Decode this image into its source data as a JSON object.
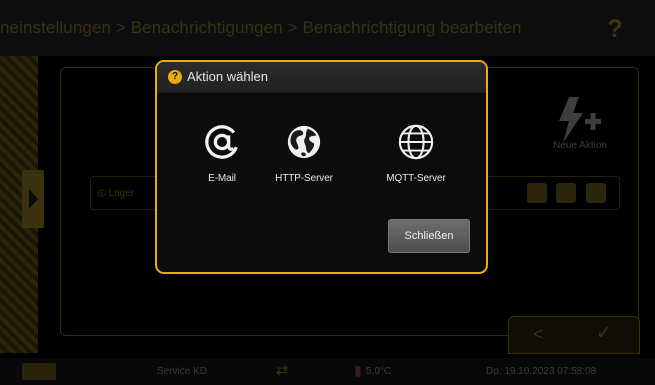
{
  "topbar": {
    "breadcrumb": "neinstellungen > Benachrichtigungen > Benachrichtigung bearbeiten",
    "help_glyph": "?"
  },
  "background": {
    "new_action_label": "Neue Aktion",
    "notification_row_label": "Lager"
  },
  "modal": {
    "help_glyph": "?",
    "title": "Aktion wählen",
    "actions": [
      {
        "label": "E-Mail",
        "icon": "at-sign-icon"
      },
      {
        "label": "HTTP-Server",
        "icon": "globe-icon"
      },
      {
        "label": "MQTT-Server",
        "icon": "network-globe-icon"
      }
    ],
    "close_label": "Schließen"
  },
  "statusbar": {
    "service": "Service KD",
    "temperature": "5.0°C",
    "datetime": "Do. 19.10.2023 07:58:08"
  },
  "colors": {
    "accent": "#e9b10e",
    "modal_bg": "#0c0c0c",
    "button_grey": "#5e5e5e"
  }
}
